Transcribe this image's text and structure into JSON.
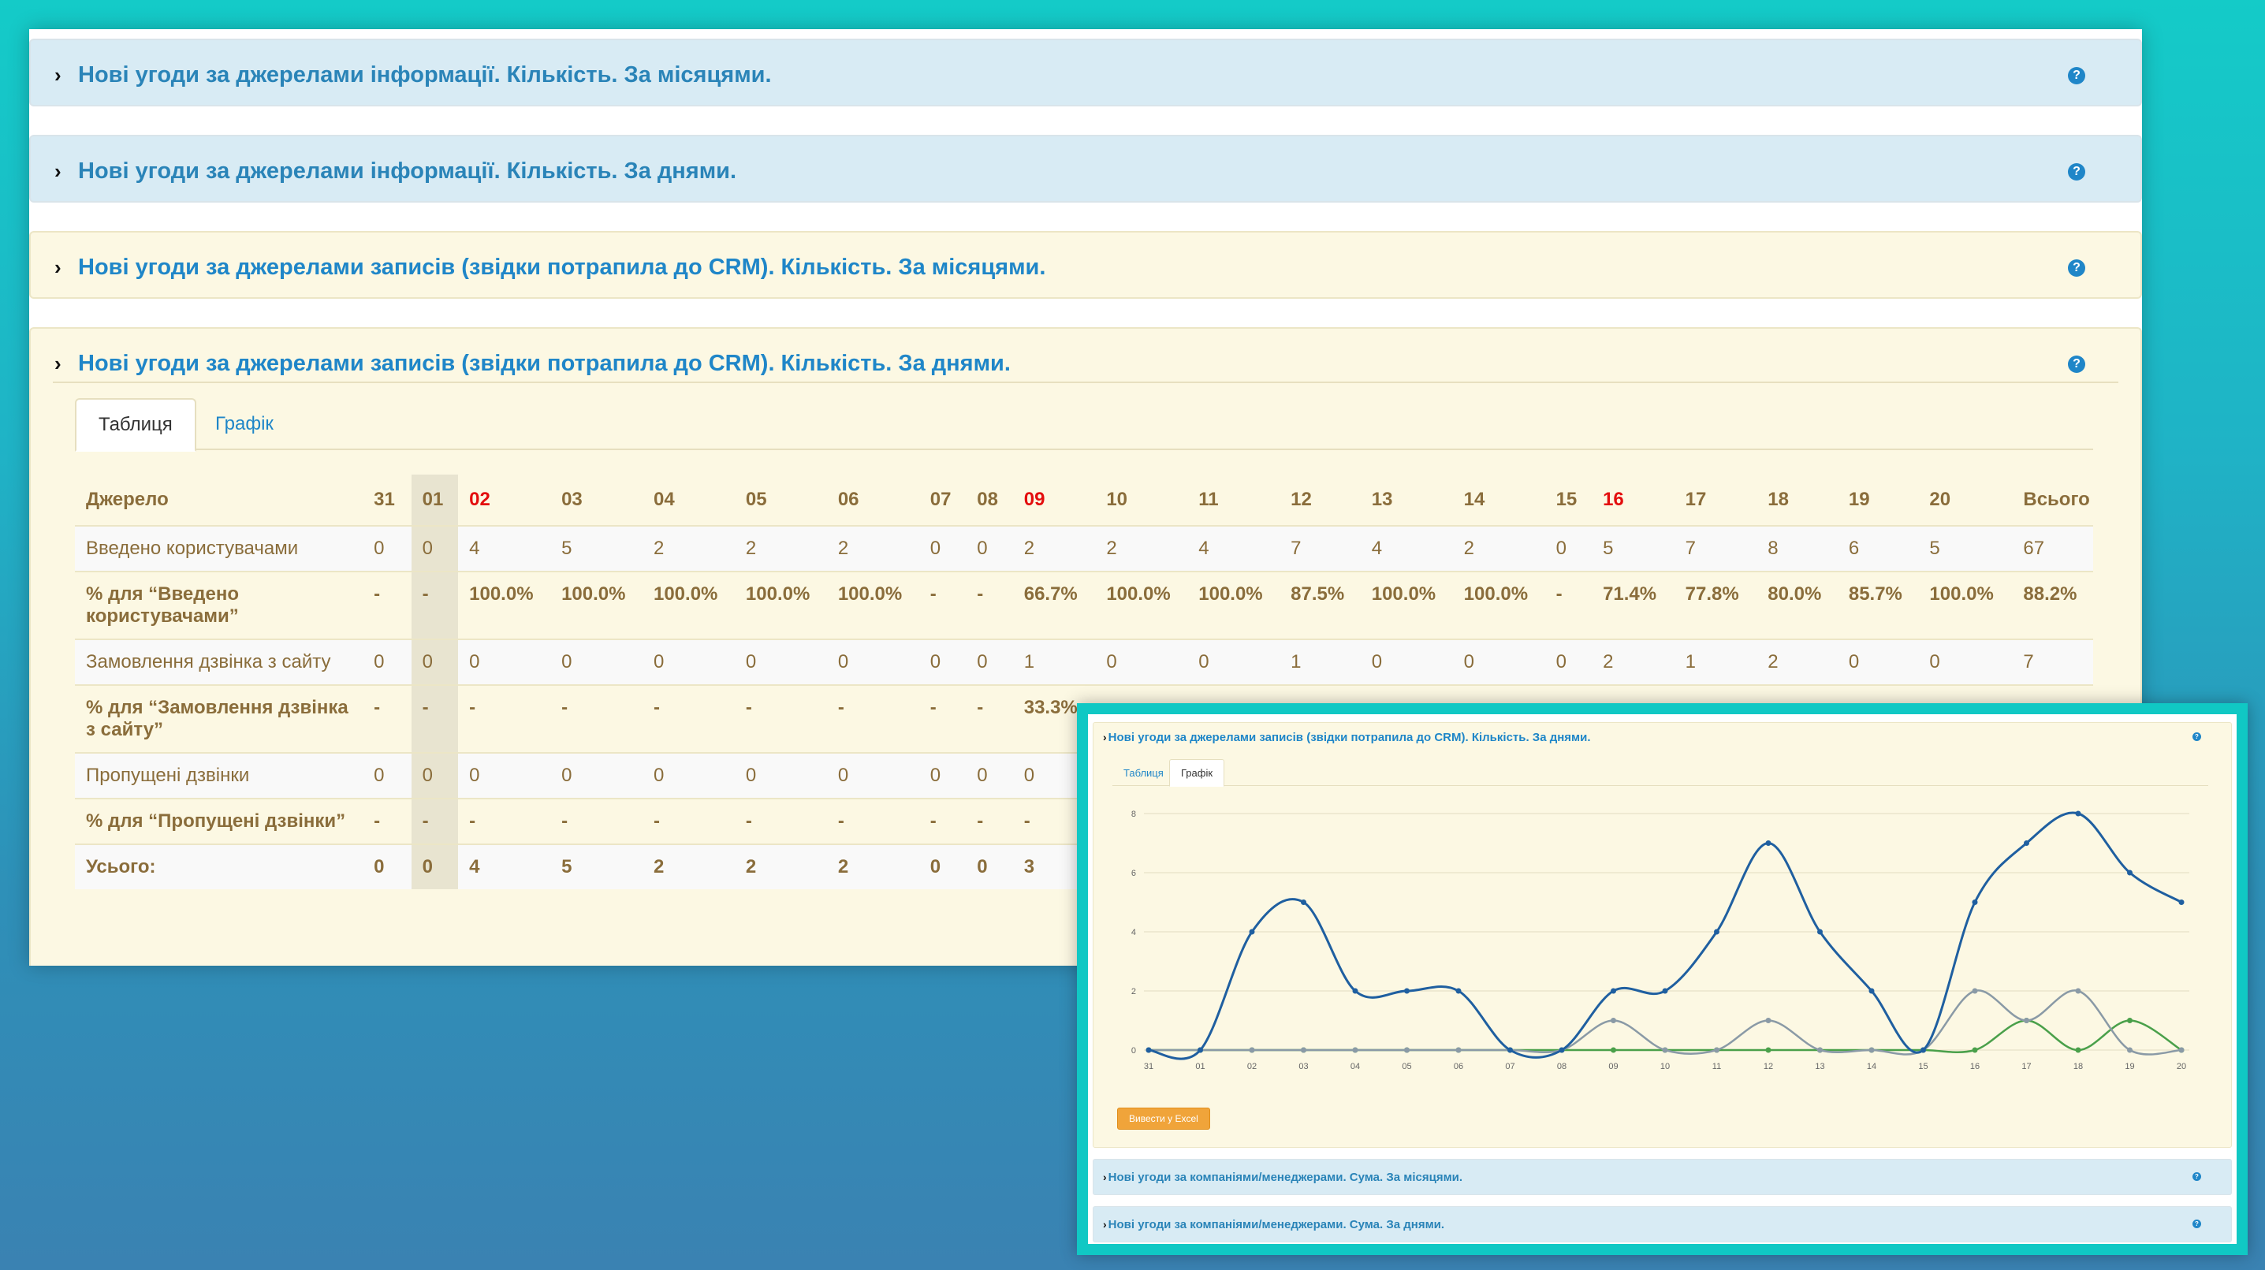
{
  "panels": [
    {
      "title": "Нові угоди за джерелами інформації. Кількість. За місяцями."
    },
    {
      "title": "Нові угоди за джерелами інформації. Кількість. За днями."
    },
    {
      "title": "Нові угоди за джерелами записів (звідки потрапила до CRM). Кількість. За місяцями."
    },
    {
      "title": "Нові угоди за джерелами записів (звідки потрапила до CRM). Кількість. За днями."
    }
  ],
  "help_glyph": "?",
  "chevron_glyph": "›",
  "tabs": {
    "table": "Таблиця",
    "chart": "Графік"
  },
  "table": {
    "headers": [
      "Джерело",
      "31",
      "01",
      "02",
      "03",
      "04",
      "05",
      "06",
      "07",
      "08",
      "09",
      "10",
      "11",
      "12",
      "13",
      "14",
      "15",
      "16",
      "17",
      "18",
      "19",
      "20",
      "Всього"
    ],
    "rows": [
      {
        "label": "Введено користувачами",
        "cells": [
          "0",
          "0",
          "4",
          "5",
          "2",
          "2",
          "2",
          "0",
          "0",
          "2",
          "2",
          "4",
          "7",
          "4",
          "2",
          "0",
          "5",
          "7",
          "8",
          "6",
          "5",
          "67"
        ]
      },
      {
        "label": "% для “Введено користувачами”",
        "cells": [
          "-",
          "-",
          "100.0%",
          "100.0%",
          "100.0%",
          "100.0%",
          "100.0%",
          "-",
          "-",
          "66.7%",
          "100.0%",
          "100.0%",
          "87.5%",
          "100.0%",
          "100.0%",
          "-",
          "71.4%",
          "77.8%",
          "80.0%",
          "85.7%",
          "100.0%",
          "88.2%"
        ]
      },
      {
        "label": "Замовлення дзвінка з сайту",
        "cells": [
          "0",
          "0",
          "0",
          "0",
          "0",
          "0",
          "0",
          "0",
          "0",
          "1",
          "0",
          "0",
          "1",
          "0",
          "0",
          "0",
          "2",
          "1",
          "2",
          "0",
          "0",
          "7"
        ]
      },
      {
        "label": "% для “Замовлення дзвінка з сайту”",
        "cells": [
          "-",
          "-",
          "-",
          "-",
          "-",
          "-",
          "-",
          "-",
          "-",
          "33.3%",
          "",
          "",
          "",
          "",
          "",
          "",
          "",
          "",
          "",
          "",
          "",
          ""
        ]
      },
      {
        "label": "Пропущені дзвінки",
        "cells": [
          "0",
          "0",
          "0",
          "0",
          "0",
          "0",
          "0",
          "0",
          "0",
          "0",
          "",
          "",
          "",
          "",
          "",
          "",
          "",
          "",
          "",
          "",
          "",
          ""
        ]
      },
      {
        "label": "% для “Пропущені дзвінки”",
        "cells": [
          "-",
          "-",
          "-",
          "-",
          "-",
          "-",
          "-",
          "-",
          "-",
          "-",
          "",
          "",
          "",
          "",
          "",
          "",
          "",
          "",
          "",
          "",
          "",
          ""
        ]
      },
      {
        "label": "Усього:",
        "cells": [
          "0",
          "0",
          "4",
          "5",
          "2",
          "2",
          "2",
          "0",
          "0",
          "3",
          "",
          "",
          "",
          "",
          "",
          "",
          "",
          "",
          "",
          "",
          "",
          ""
        ]
      }
    ]
  },
  "inset": {
    "panel_title": "Нові угоди за джерелами записів (звідки потрапила до CRM). Кількість. За днями.",
    "tabs": {
      "table": "Таблиця",
      "chart": "Графік"
    },
    "excel_button": "Вивести у Excel",
    "bottom_panels": [
      {
        "title": "Нові угоди за компаніями/менеджерами. Сума. За місяцями."
      },
      {
        "title": "Нові угоди за компаніями/менеджерами. Сума. За днями."
      }
    ]
  },
  "chart_data": {
    "type": "line",
    "x": [
      "31",
      "01",
      "02",
      "03",
      "04",
      "05",
      "06",
      "07",
      "08",
      "09",
      "10",
      "11",
      "12",
      "13",
      "14",
      "15",
      "16",
      "17",
      "18",
      "19",
      "20"
    ],
    "ylim": [
      0,
      8
    ],
    "yticks": [
      0,
      2,
      4,
      6,
      8
    ],
    "grid": true,
    "series": [
      {
        "color": "#1f5fa0",
        "values": [
          0,
          0,
          4,
          5,
          2,
          2,
          2,
          0,
          0,
          2,
          2,
          4,
          7,
          4,
          2,
          0,
          5,
          7,
          8,
          6,
          5
        ]
      },
      {
        "color": "#8a9aa6",
        "values": [
          0,
          0,
          0,
          0,
          0,
          0,
          0,
          0,
          0,
          1,
          0,
          0,
          1,
          0,
          0,
          0,
          2,
          1,
          2,
          0,
          0
        ]
      },
      {
        "color": "#4aa04a",
        "values": [
          0,
          0,
          0,
          0,
          0,
          0,
          0,
          0,
          0,
          0,
          0,
          0,
          0,
          0,
          0,
          0,
          0,
          1,
          0,
          1,
          0
        ]
      }
    ]
  }
}
